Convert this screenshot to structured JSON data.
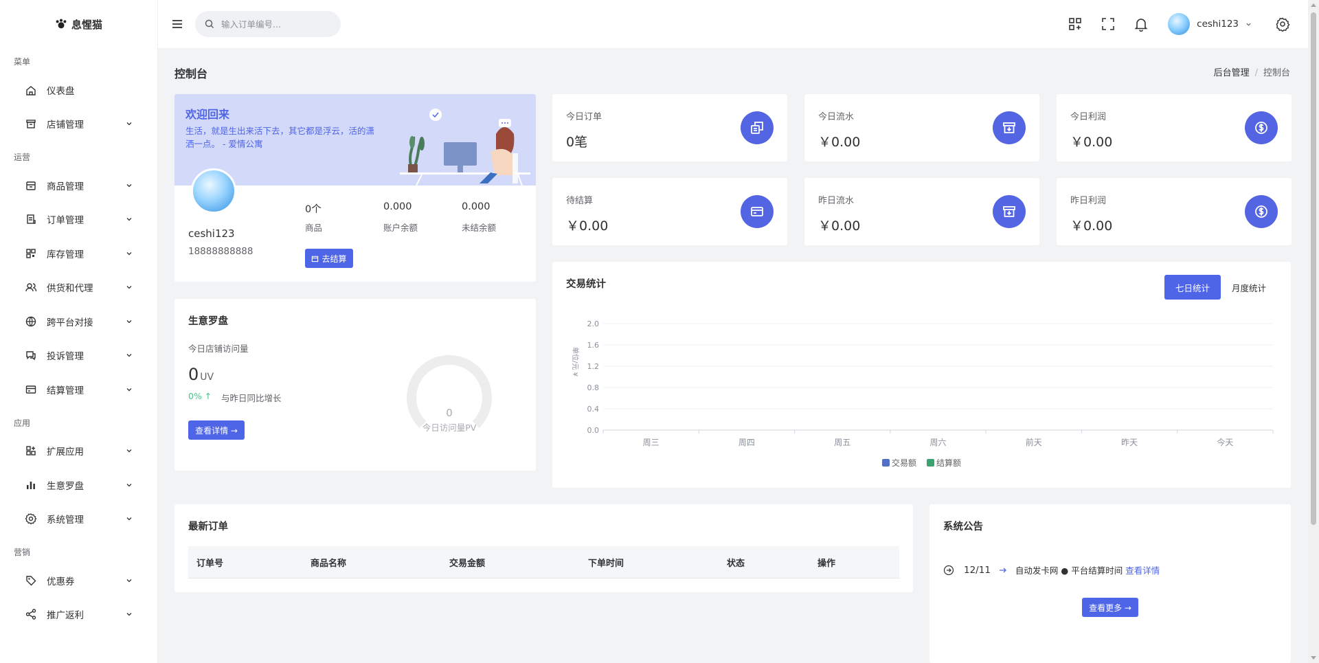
{
  "app": {
    "logo_text": "息惺猫"
  },
  "topbar": {
    "search_placeholder": "输入订单编号...",
    "username": "ceshi123"
  },
  "sidebar": {
    "groups": [
      {
        "title": "菜单",
        "items": [
          {
            "label": "仪表盘",
            "icon": "home-icon",
            "has_children": false
          },
          {
            "label": "店铺管理",
            "icon": "store-icon",
            "has_children": true
          }
        ]
      },
      {
        "title": "运营",
        "items": [
          {
            "label": "商品管理",
            "icon": "box-icon",
            "has_children": true
          },
          {
            "label": "订单管理",
            "icon": "order-icon",
            "has_children": true
          },
          {
            "label": "库存管理",
            "icon": "grid-icon",
            "has_children": true
          },
          {
            "label": "供货和代理",
            "icon": "users-icon",
            "has_children": true
          },
          {
            "label": "跨平台对接",
            "icon": "globe-icon",
            "has_children": true
          },
          {
            "label": "投诉管理",
            "icon": "chat-icon",
            "has_children": true
          },
          {
            "label": "结算管理",
            "icon": "card-icon",
            "has_children": true
          }
        ]
      },
      {
        "title": "应用",
        "items": [
          {
            "label": "扩展应用",
            "icon": "apps-icon",
            "has_children": true
          },
          {
            "label": "生意罗盘",
            "icon": "bar-chart-icon",
            "has_children": true
          },
          {
            "label": "系统管理",
            "icon": "gear-icon",
            "has_children": true
          }
        ]
      },
      {
        "title": "营销",
        "items": [
          {
            "label": "优惠券",
            "icon": "tag-icon",
            "has_children": true
          },
          {
            "label": "推广返利",
            "icon": "share-icon",
            "has_children": true
          }
        ]
      }
    ]
  },
  "page": {
    "title": "控制台",
    "breadcrumb": [
      "后台管理",
      "控制台"
    ]
  },
  "welcome": {
    "title": "欢迎回来",
    "subtitle": "生活，就是生出来活下去，其它都是浮云，活的潇洒一点。 - 爱情公寓",
    "username": "ceshi123",
    "phone": "18888888888",
    "stats": [
      {
        "value": "0个",
        "label": "商品"
      },
      {
        "value": "0.000",
        "label": "账户余额"
      },
      {
        "value": "0.000",
        "label": "未结余额"
      }
    ],
    "settle_button": "去结算"
  },
  "stat_cards": [
    {
      "title": "今日订单",
      "value": "0笔",
      "icon": "copy-icon"
    },
    {
      "title": "今日流水",
      "value": "￥0.00",
      "icon": "archive-icon"
    },
    {
      "title": "今日利润",
      "value": "￥0.00",
      "icon": "dollar-icon"
    },
    {
      "title": "待结算",
      "value": "￥0.00",
      "icon": "card-icon"
    },
    {
      "title": "昨日流水",
      "value": "￥0.00",
      "icon": "archive-icon"
    },
    {
      "title": "昨日利润",
      "value": "￥0.00",
      "icon": "dollar-icon"
    }
  ],
  "compass": {
    "title": "生意罗盘",
    "subtitle": "今日店铺访问量",
    "uv_value": "0",
    "uv_unit": "UV",
    "pct": "0% ↑",
    "pct_label": "与昨日同比增长",
    "detail_button": "查看详情 →",
    "gauge_value": "0",
    "gauge_label": "今日访问量PV",
    "gauge_level": 0
  },
  "trade": {
    "title": "交易统计",
    "tabs": [
      {
        "label": "七日统计",
        "active": true
      },
      {
        "label": "月度统计",
        "active": false
      }
    ]
  },
  "chart_data": {
    "type": "bar",
    "title": "",
    "xlabel": "",
    "ylabel": "单位/元 ¥",
    "categories": [
      "周三",
      "周四",
      "周五",
      "周六",
      "前天",
      "昨天",
      "今天"
    ],
    "series": [
      {
        "name": "交易额",
        "color": "#5470c6",
        "values": [
          0,
          0,
          0,
          0,
          0,
          0,
          0
        ]
      },
      {
        "name": "结算额",
        "color": "#3ba272",
        "values": [
          0,
          0,
          0,
          0,
          0,
          0,
          0
        ]
      }
    ],
    "yticks": [
      "0.0",
      "0.4",
      "0.8",
      "1.2",
      "1.6",
      "2.0"
    ],
    "ylim": [
      0,
      2
    ],
    "legend_position": "bottom",
    "grid": true
  },
  "orders": {
    "title": "最新订单",
    "columns": [
      "订单号",
      "商品名称",
      "交易金额",
      "下单时间",
      "状态",
      "操作"
    ]
  },
  "notice": {
    "title": "系统公告",
    "items": [
      {
        "date": "12/11",
        "text": "自动发卡网 ● 平台结算时间",
        "link": "查看详情"
      }
    ],
    "more_button": "查看更多 →"
  }
}
